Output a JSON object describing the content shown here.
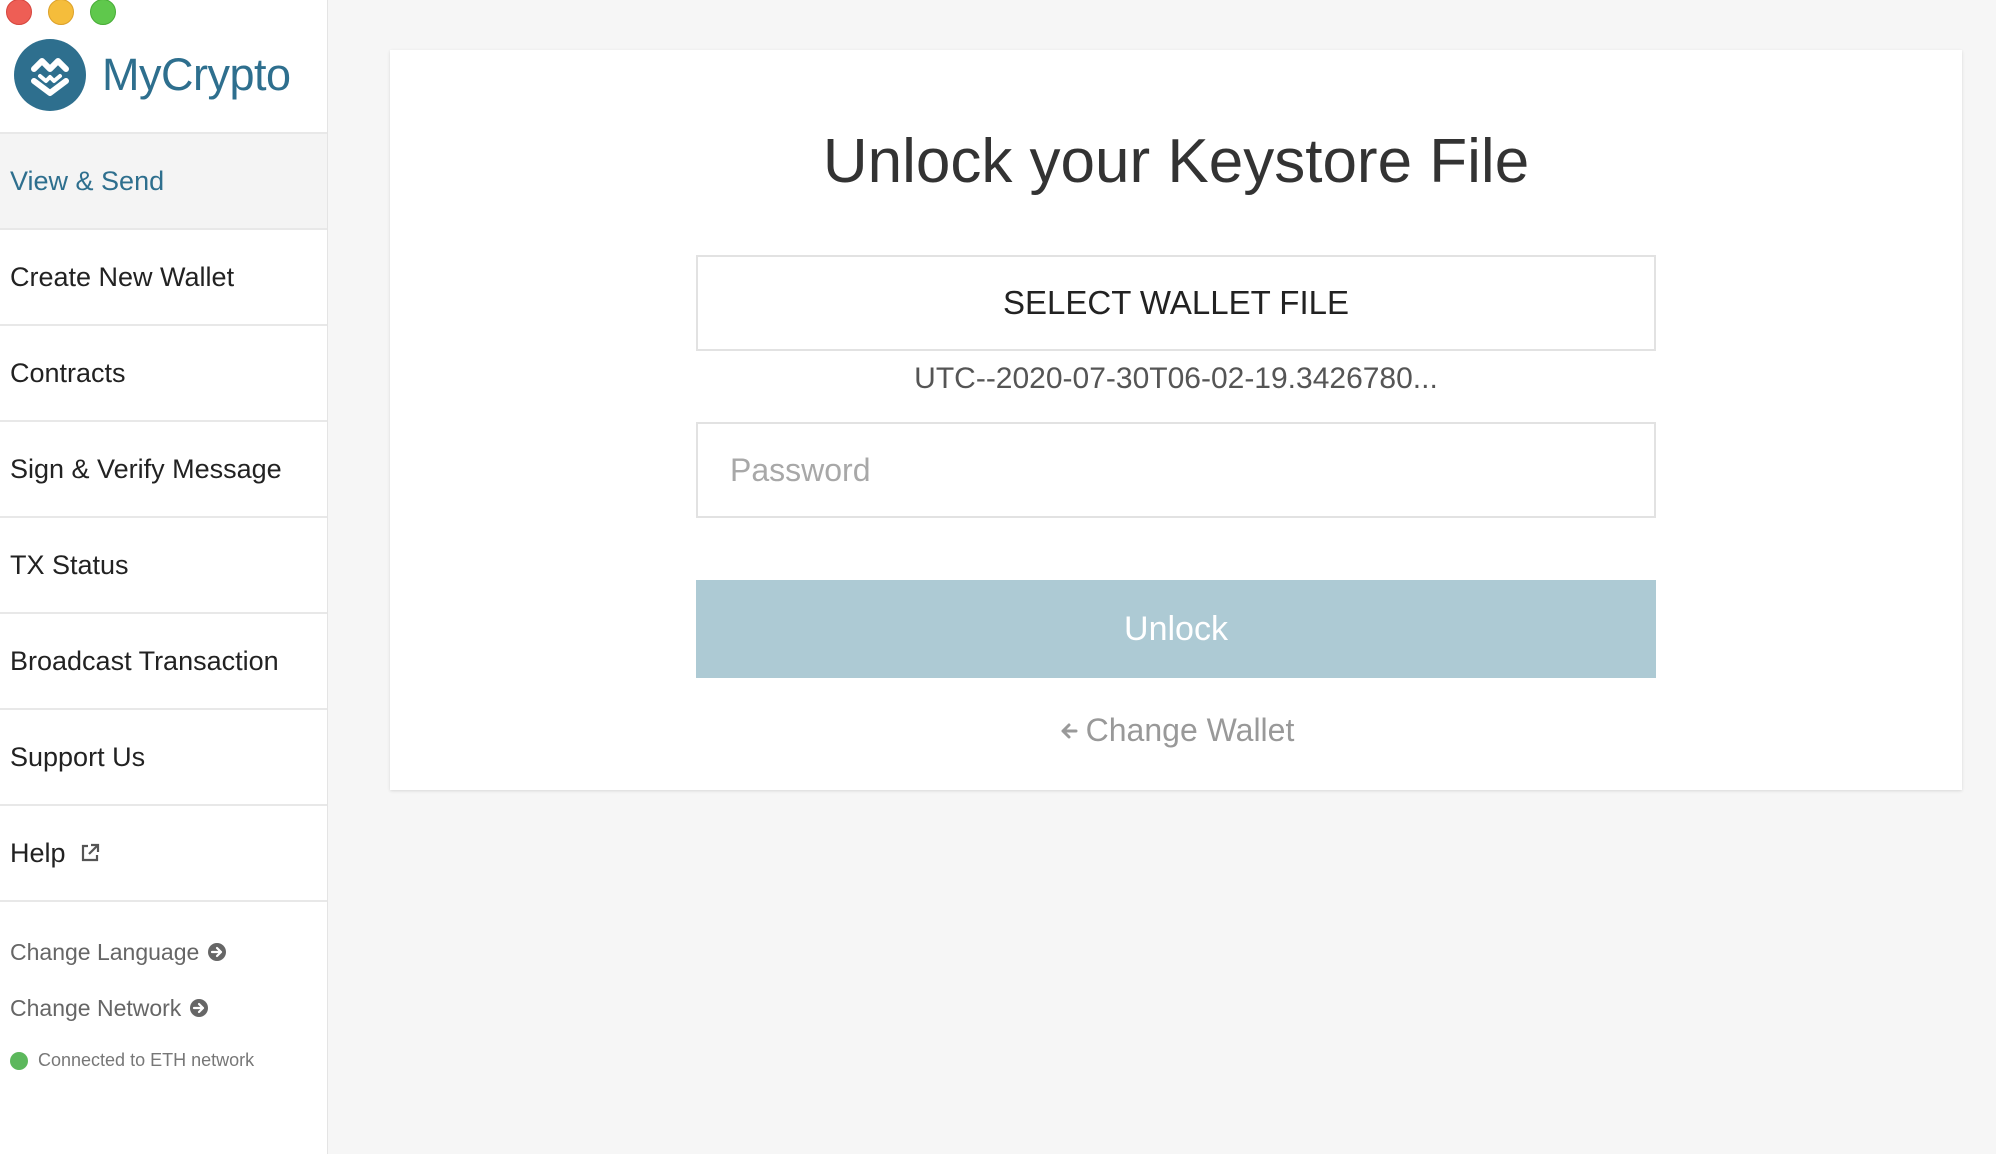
{
  "brand": {
    "name": "MyCrypto"
  },
  "sidebar": {
    "items": [
      {
        "label": "View & Send",
        "active": true
      },
      {
        "label": "Create New Wallet"
      },
      {
        "label": "Contracts"
      },
      {
        "label": "Sign & Verify Message"
      },
      {
        "label": "TX Status"
      },
      {
        "label": "Broadcast Transaction"
      },
      {
        "label": "Support Us"
      },
      {
        "label": "Help",
        "icon": "external-link-icon"
      }
    ],
    "footer": {
      "change_language": "Change Language",
      "change_network": "Change Network",
      "status": "Connected to ETH network"
    }
  },
  "unlock": {
    "title": "Unlock your Keystore File",
    "select_file_label": "SELECT WALLET FILE",
    "filename": "UTC--2020-07-30T06-02-19.3426780...",
    "password_placeholder": "Password",
    "password_value": "",
    "unlock_label": "Unlock",
    "change_wallet_label": "Change Wallet"
  },
  "colors": {
    "brand": "#2e6f8e",
    "unlock_button": "#adcad4",
    "status_dot": "#5cb85c"
  }
}
